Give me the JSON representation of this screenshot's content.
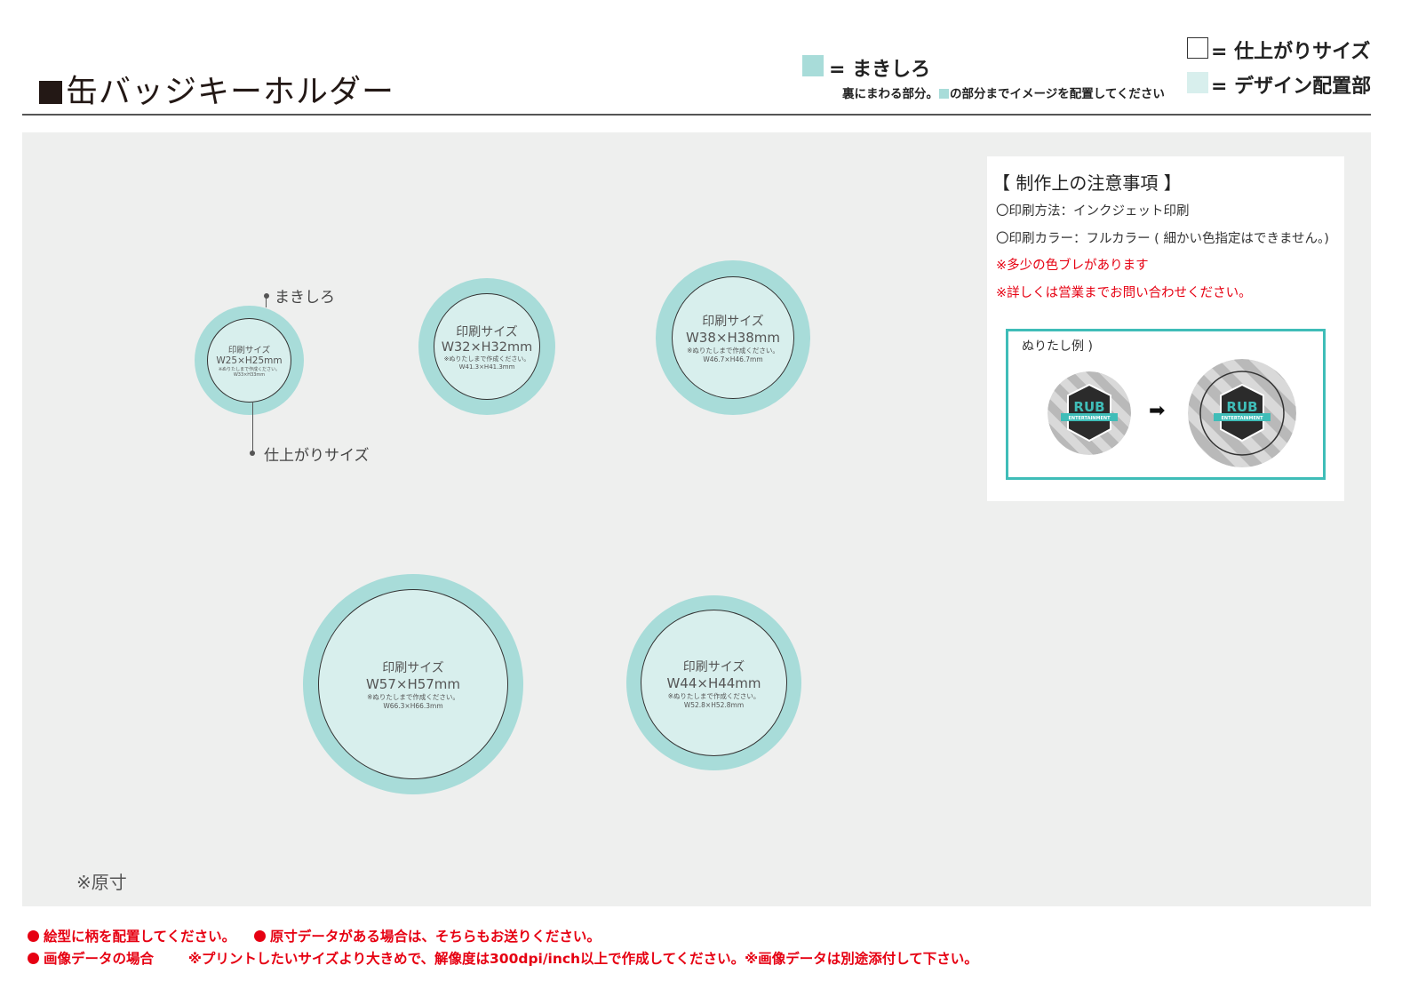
{
  "header": {
    "title": "缶バッジキーホルダー",
    "legend": {
      "makishiro_label": "= まきしろ",
      "makishiro_note_a": "裏にまわる部分。",
      "makishiro_note_b": "の部分までイメージを配置してください",
      "finish_label": "= 仕上がりサイズ",
      "design_label": "= デザイン配置部"
    }
  },
  "colors": {
    "makishiro": "#a8dcd9",
    "design": "#d8efed",
    "canvas": "#eeefee",
    "warning": "#e60012",
    "example_border": "#3fbdb8"
  },
  "badges": [
    {
      "name": "badge-25mm",
      "label": "印刷サイズ",
      "size": "W25×H25mm",
      "note": "※ぬりたしまで作成ください。",
      "bleed": "W33×H33mm"
    },
    {
      "name": "badge-32mm",
      "label": "印刷サイズ",
      "size": "W32×H32mm",
      "note": "※ぬりたしまで作成ください。",
      "bleed": "W41.3×H41.3mm"
    },
    {
      "name": "badge-38mm",
      "label": "印刷サイズ",
      "size": "W38×H38mm",
      "note": "※ぬりたしまで作成ください。",
      "bleed": "W46.7×H46.7mm"
    },
    {
      "name": "badge-57mm",
      "label": "印刷サイズ",
      "size": "W57×H57mm",
      "note": "※ぬりたしまで作成ください。",
      "bleed": "W66.3×H66.3mm"
    },
    {
      "name": "badge-44mm",
      "label": "印刷サイズ",
      "size": "W44×H44mm",
      "note": "※ぬりたしまで作成ください。",
      "bleed": "W52.8×H52.8mm"
    }
  ],
  "callouts": {
    "makishiro": "まきしろ",
    "finish": "仕上がりサイズ"
  },
  "original_size": "※原寸",
  "notes": {
    "title": "【 制作上の注意事項 】",
    "method": "〇印刷方法：インクジェット印刷",
    "color": "〇印刷カラー：フルカラー ( 細かい色指定はできません。)",
    "warn1": "※多少の色ブレがあります",
    "warn2": "※詳しくは営業までお問い合わせください。",
    "example_label": "ぬりたし例 )",
    "arrow": "➡",
    "logo_main": "RUB",
    "logo_ribbon": "ENTERTAINMENT"
  },
  "footer": {
    "line1a": "絵型に柄を配置してください。",
    "line1b": "原寸データがある場合は、そちらもお送りください。",
    "line2a": "画像データの場合",
    "line2b": "※プリントしたいサイズより大きめで、解像度は300dpi/inch以上で作成してください。※画像データは別途添付して下さい。"
  }
}
